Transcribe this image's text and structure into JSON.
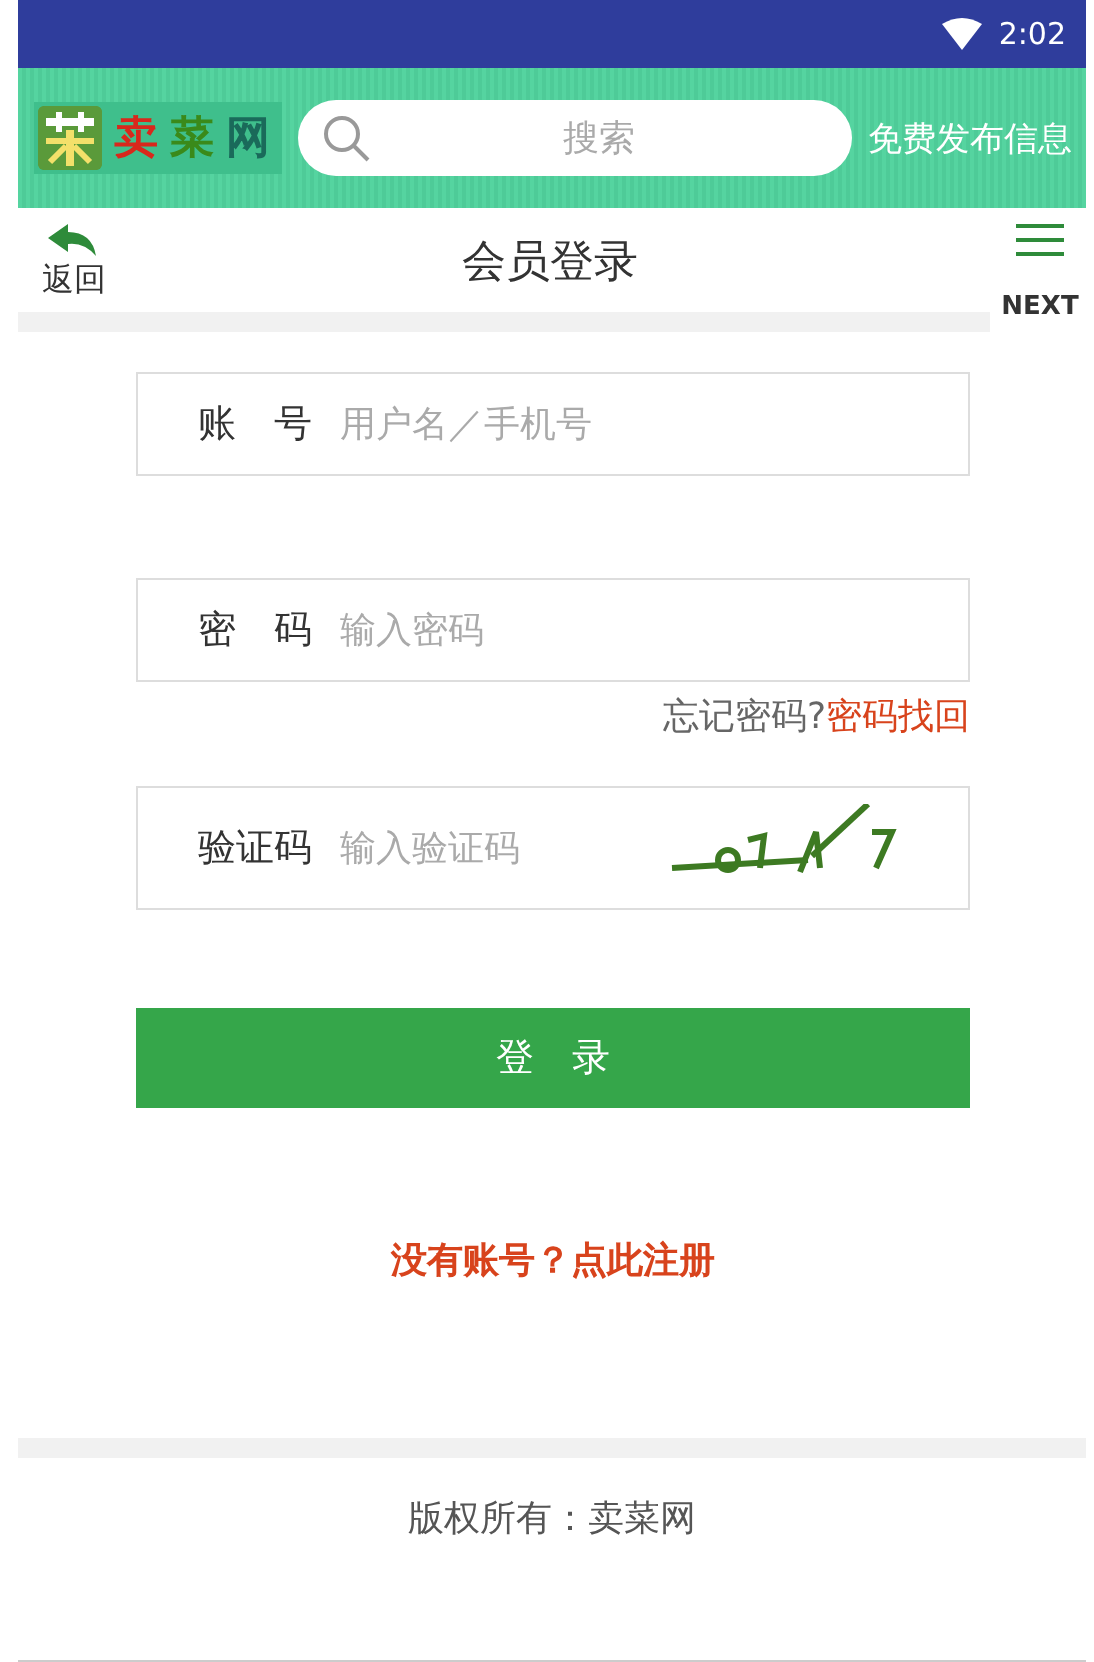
{
  "status_bar": {
    "time": "2:02"
  },
  "header": {
    "logo": [
      "卖",
      "菜",
      "网"
    ],
    "search": {
      "placeholder": "搜索"
    },
    "publish": "免费发布信息"
  },
  "nav": {
    "back": "返回",
    "title": "会员登录",
    "next": "NEXT"
  },
  "form": {
    "fields": [
      {
        "label": "账　号",
        "placeholder": "用户名／手机号"
      },
      {
        "label": "密　码",
        "placeholder": "输入密码"
      }
    ],
    "forgot": {
      "prompt": "忘记密码?",
      "link": "密码找回"
    },
    "captcha": {
      "label": "验证码",
      "placeholder": "输入验证码"
    },
    "submit": "登　录",
    "register": "没有账号？点此注册"
  },
  "footer": {
    "copyright": "版权所有：卖菜网"
  }
}
